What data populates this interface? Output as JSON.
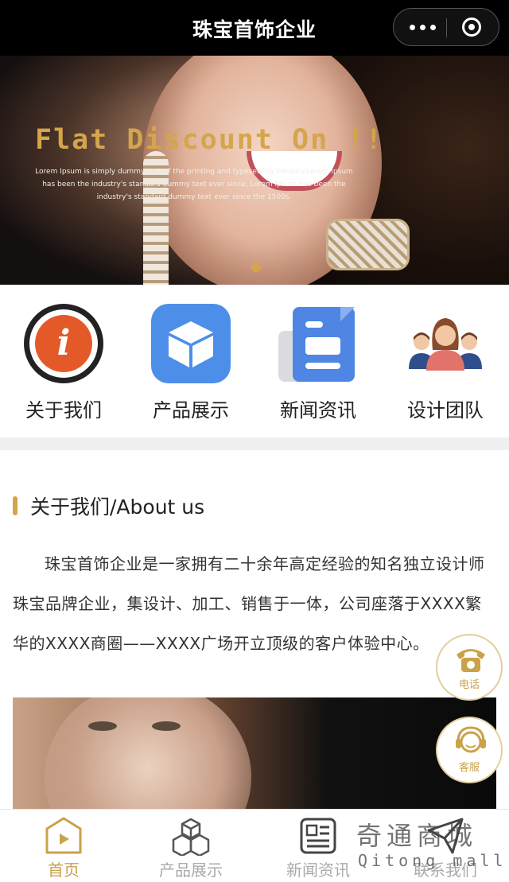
{
  "window": {
    "title": "珠宝首饰企业"
  },
  "banner": {
    "headline": "Flat Discount On !!",
    "lead": "Lorem Ipsum is simply dummy text of the printing and typesetting industry.Lorem Ipsum has been the industry's standard dummy text ever since, Lorem Ipsum has been the industry's standard dummy text ever since the 1500s.",
    "accent_color": "#d4a54a"
  },
  "nav_grid": [
    {
      "label": "关于我们",
      "icon": "info-icon"
    },
    {
      "label": "产品展示",
      "icon": "cube-icon"
    },
    {
      "label": "新闻资讯",
      "icon": "document-icon"
    },
    {
      "label": "设计团队",
      "icon": "team-icon"
    }
  ],
  "about": {
    "heading": "关于我们/About us",
    "body": "珠宝首饰企业是一家拥有二十余年高定经验的知名独立设计师珠宝品牌企业，集设计、加工、销售于一体，公司座落于XXXX繁华的XXXX商圈——XXXX广场开立顶级的客户体验中心。"
  },
  "floating": {
    "phone_label": "电话",
    "service_label": "客服"
  },
  "tabbar": {
    "tabs": [
      {
        "label": "首页",
        "icon": "home-play-icon",
        "active": true
      },
      {
        "label": "产品展示",
        "icon": "cubes-icon",
        "active": false
      },
      {
        "label": "新闻资讯",
        "icon": "news-icon",
        "active": false
      },
      {
        "label": "联系我们",
        "icon": "contact-icon",
        "active": false
      }
    ],
    "active_color": "#c9a24a"
  },
  "watermark": {
    "cn": "奇通商城",
    "en": "Qitong mall"
  }
}
